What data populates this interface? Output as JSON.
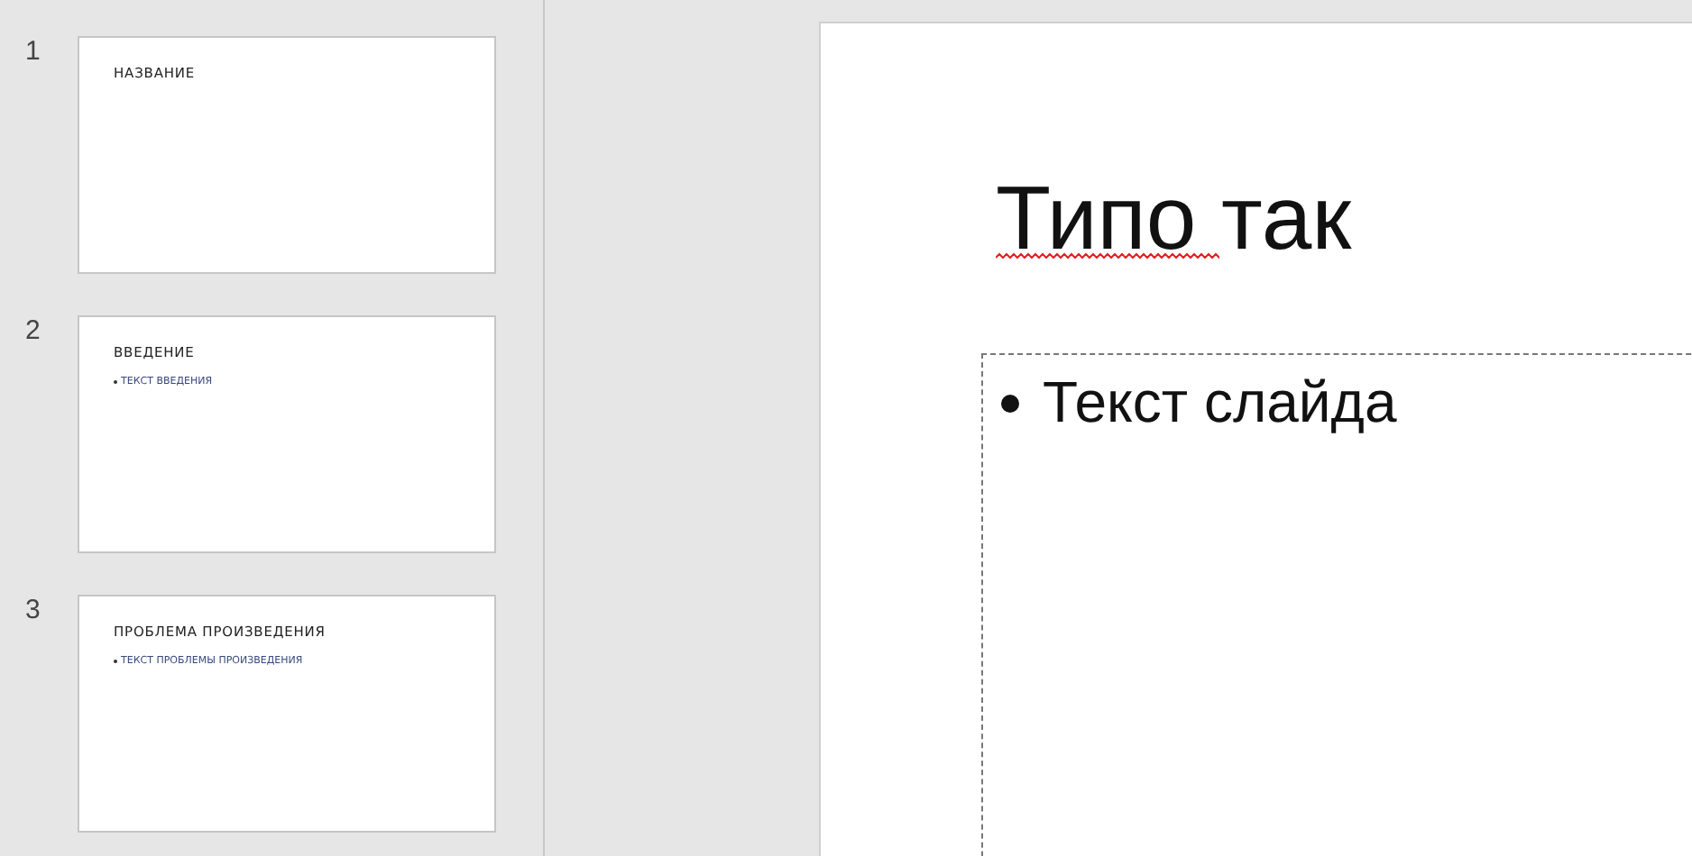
{
  "thumbnails": [
    {
      "number": "1",
      "selected": false,
      "title": "НАЗВАНИЕ"
    },
    {
      "number": "2",
      "selected": false,
      "title": "ВВЕДЕНИЕ",
      "bullets": [
        "ТЕКСТ ВВЕДЕНИЯ"
      ]
    },
    {
      "number": "3",
      "selected": false,
      "title": "ПРОБЛЕМА ПРОИЗВЕДЕНИЯ",
      "bullets": [
        "ТЕКСТ ПРОБЛЕМЫ ПРОИЗВЕДЕНИЯ"
      ]
    }
  ],
  "slide": {
    "title": "Типо так",
    "title_misspelled": true,
    "bullets": [
      "Текст слайда"
    ]
  }
}
